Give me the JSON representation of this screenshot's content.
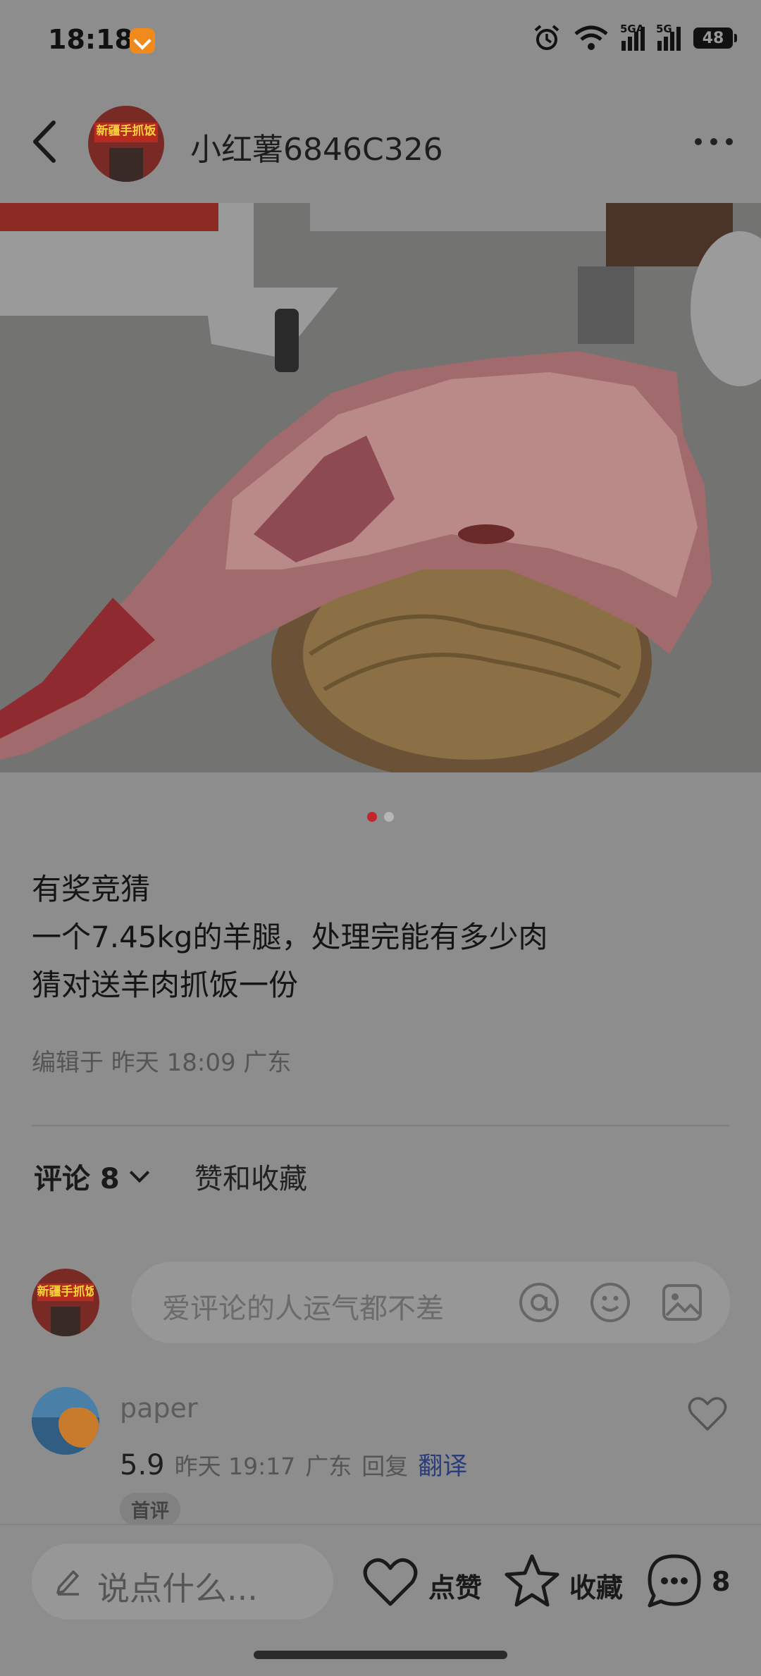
{
  "status_bar": {
    "time": "18:18",
    "signal_1_label": "5GA",
    "signal_2_label": "5G",
    "battery": "48",
    "icons": [
      "app-notification-icon",
      "alarm-icon",
      "wifi-icon",
      "signal-icon",
      "signal-icon",
      "battery-icon"
    ]
  },
  "header": {
    "author_name": "小红薯6846C326",
    "avatar_sign": "新疆手抓饭"
  },
  "carousel": {
    "count": 2,
    "active_index": 0
  },
  "post": {
    "lines": [
      "有奖竞猜",
      "一个7.45kg的羊腿，处理完能有多少肉",
      "猜对送羊肉抓饭一份"
    ],
    "meta": "编辑于 昨天 18:09 广东"
  },
  "tabs": {
    "comments_label": "评论 8",
    "likes_label": "赞和收藏"
  },
  "comment_input": {
    "placeholder": "爱评论的人运气都不差",
    "avatar_sign": "新疆手抓饭"
  },
  "comments": [
    {
      "user": "paper",
      "text": "5.9",
      "time": "昨天 19:17",
      "location": "广东",
      "reply": "回复",
      "translate": "翻译",
      "badge": "首评"
    }
  ],
  "bottom_bar": {
    "input_label": "说点什么...",
    "like_label": "点赞",
    "collect_label": "收藏",
    "comment_count": "8"
  },
  "colors": {
    "overlay_bg": "#8d8d8d",
    "active_dot": "#c2262b",
    "translate_link": "#2a3d7a"
  }
}
